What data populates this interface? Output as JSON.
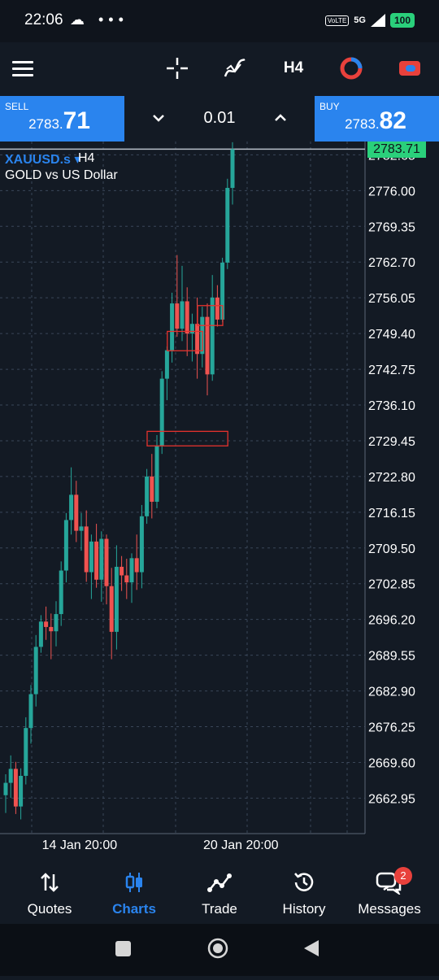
{
  "status_bar": {
    "time": "22:06",
    "left_icons": "☁ •••",
    "volte": "VoLTE",
    "network": "5G",
    "battery": "100"
  },
  "toolbar": {
    "timeframe": "H4"
  },
  "trade_bar": {
    "sell_label": "SELL",
    "sell_price_small": "2783.",
    "sell_price_big": "71",
    "lot": "0.01",
    "buy_label": "BUY",
    "buy_price_small": "2783.",
    "buy_price_big": "82"
  },
  "chart": {
    "symbol": "XAUUSD.s",
    "symbol_arrow": "▾",
    "timeframe": "H4",
    "description": "GOLD vs US Dollar",
    "current_price": "2783.71",
    "price_levels": [
      "2782.65",
      "2776.00",
      "2769.35",
      "2762.70",
      "2756.05",
      "2749.40",
      "2742.75",
      "2736.10",
      "2729.45",
      "2722.80",
      "2716.15",
      "2709.50",
      "2702.85",
      "2696.20",
      "2689.55",
      "2682.90",
      "2676.25",
      "2669.60",
      "2662.95"
    ],
    "date_labels": [
      "14 Jan 20:00",
      "20 Jan 20:00"
    ]
  },
  "chart_data": {
    "type": "candlestick",
    "title": "",
    "ylim": [
      2658,
      2787
    ],
    "x_tick_labels": [
      "14 Jan 20:00",
      "20 Jan 20:00"
    ],
    "x_tick_index": [
      8,
      40
    ],
    "candles_ohlc": [
      [
        2663.5,
        2667.4,
        2660.2,
        2665.8
      ],
      [
        2665.8,
        2670.9,
        2663.0,
        2668.4
      ],
      [
        2668.4,
        2669.7,
        2660.0,
        2661.4
      ],
      [
        2661.4,
        2668.5,
        2659.0,
        2667.1
      ],
      [
        2667.1,
        2678.0,
        2665.5,
        2676.0
      ],
      [
        2676.0,
        2684.0,
        2673.1,
        2682.3
      ],
      [
        2682.3,
        2693.3,
        2680.0,
        2691.1
      ],
      [
        2691.1,
        2697.0,
        2690.0,
        2695.8
      ],
      [
        2695.8,
        2698.6,
        2692.4,
        2694.8
      ],
      [
        2694.8,
        2697.3,
        2688.8,
        2694.0
      ],
      [
        2694.0,
        2699.6,
        2691.2,
        2697.2
      ],
      [
        2697.2,
        2707.0,
        2695.0,
        2705.3
      ],
      [
        2705.3,
        2716.0,
        2703.1,
        2714.7
      ],
      [
        2714.7,
        2724.5,
        2712.0,
        2719.4
      ],
      [
        2719.4,
        2722.0,
        2710.6,
        2712.7
      ],
      [
        2712.7,
        2716.0,
        2709.0,
        2713.5
      ],
      [
        2713.5,
        2716.5,
        2703.2,
        2705.0
      ],
      [
        2705.0,
        2712.0,
        2700.0,
        2710.7
      ],
      [
        2710.7,
        2714.0,
        2702.1,
        2703.6
      ],
      [
        2703.6,
        2712.6,
        2699.5,
        2711.2
      ],
      [
        2711.2,
        2712.0,
        2699.0,
        2702.4
      ],
      [
        2702.4,
        2705.8,
        2688.8,
        2693.9
      ],
      [
        2693.9,
        2710.0,
        2690.6,
        2706.0
      ],
      [
        2706.0,
        2708.0,
        2701.5,
        2704.4
      ],
      [
        2704.4,
        2707.5,
        2700.0,
        2703.1
      ],
      [
        2703.1,
        2708.5,
        2699.3,
        2707.6
      ],
      [
        2707.6,
        2712.0,
        2701.7,
        2705.0
      ],
      [
        2705.0,
        2717.5,
        2702.0,
        2715.4
      ],
      [
        2715.4,
        2724.2,
        2714.0,
        2722.8
      ],
      [
        2722.8,
        2727.0,
        2715.0,
        2718.1
      ],
      [
        2718.1,
        2730.5,
        2716.9,
        2728.5
      ],
      [
        2728.5,
        2742.4,
        2727.0,
        2741.0
      ],
      [
        2741.0,
        2747.0,
        2737.0,
        2746.3
      ],
      [
        2746.3,
        2757.0,
        2744.0,
        2755.0
      ],
      [
        2755.0,
        2764.0,
        2748.8,
        2750.3
      ],
      [
        2750.3,
        2762.0,
        2748.0,
        2755.4
      ],
      [
        2755.4,
        2758.0,
        2745.2,
        2749.4
      ],
      [
        2749.4,
        2753.1,
        2744.2,
        2751.2
      ],
      [
        2751.2,
        2756.1,
        2741.0,
        2745.6
      ],
      [
        2745.6,
        2754.4,
        2743.1,
        2752.5
      ],
      [
        2752.5,
        2755.0,
        2737.9,
        2741.8
      ],
      [
        2741.8,
        2760.3,
        2740.6,
        2756.1
      ],
      [
        2756.1,
        2758.4,
        2750.7,
        2752.0
      ],
      [
        2752.0,
        2763.5,
        2751.5,
        2762.6
      ],
      [
        2762.6,
        2778.2,
        2761.4,
        2776.5
      ],
      [
        2776.5,
        2785.0,
        2773.4,
        2783.7
      ]
    ],
    "zones": [
      {
        "price_top": 2731.2,
        "price_bottom": 2728.5,
        "from_index": 30,
        "to_index": 46
      },
      {
        "price_top": 2749.8,
        "price_bottom": 2746.2,
        "from_index": 34,
        "to_index": 41
      },
      {
        "price_top": 2754.6,
        "price_bottom": 2750.9,
        "from_index": 40,
        "to_index": 45
      }
    ],
    "colors": {
      "bull": "#26a69a",
      "bear": "#ef5350",
      "zone": "#e5322d",
      "grid": "#3a4658",
      "current_line": "#b9c0ca"
    }
  },
  "bottom_nav": [
    {
      "label": "Quotes",
      "icon": "arrows-up-down-icon"
    },
    {
      "label": "Charts",
      "icon": "candlestick-icon",
      "active": true
    },
    {
      "label": "Trade",
      "icon": "trend-line-icon"
    },
    {
      "label": "History",
      "icon": "history-clock-icon"
    },
    {
      "label": "Messages",
      "icon": "chat-bubbles-icon",
      "badge": "2"
    }
  ]
}
